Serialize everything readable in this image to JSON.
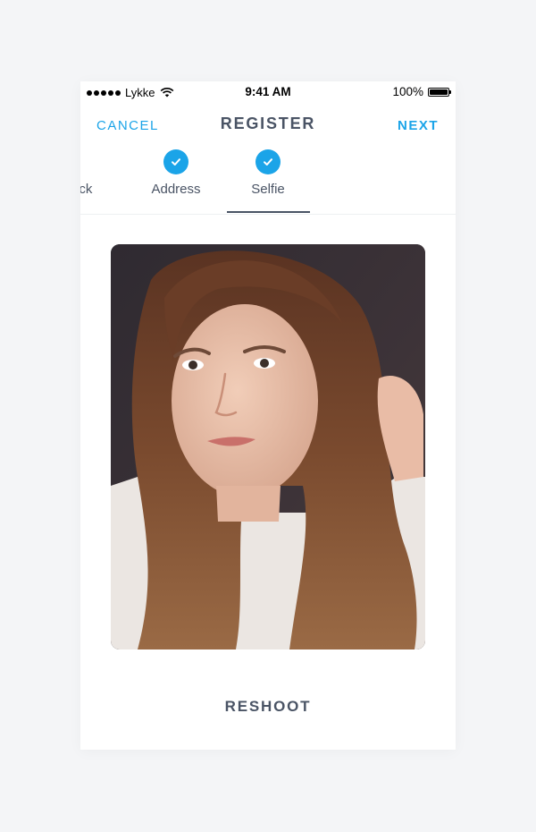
{
  "status_bar": {
    "carrier": "Lykke",
    "time": "9:41 AM",
    "battery": "100%"
  },
  "nav": {
    "cancel_label": "CANCEL",
    "title": "REGISTER",
    "next_label": "NEXT"
  },
  "steps": [
    {
      "label": "ack",
      "completed": false
    },
    {
      "label": "Address",
      "completed": true
    },
    {
      "label": "Selfie",
      "completed": true,
      "active": true
    }
  ],
  "reshoot_label": "RESHOOT",
  "colors": {
    "accent": "#1ba4e8",
    "text": "#4a5465",
    "background": "#f4f5f7"
  }
}
